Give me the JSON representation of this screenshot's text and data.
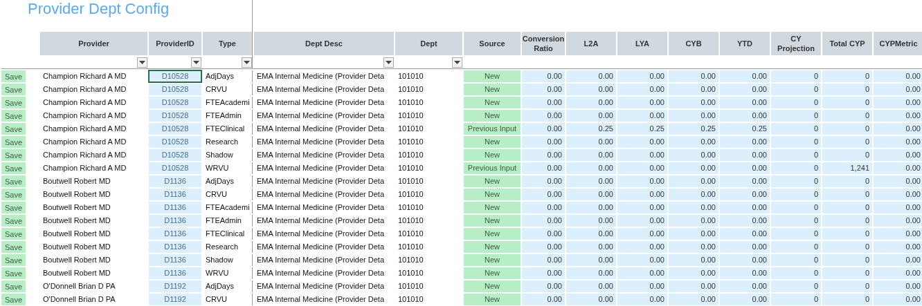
{
  "title": "Provider Dept Config",
  "columns": [
    {
      "label": "Provider",
      "filter": true
    },
    {
      "label": "ProviderID",
      "filter": true
    },
    {
      "label": "Type",
      "filter": true
    },
    {
      "label": "Dept Desc",
      "filter": true
    },
    {
      "label": "Dept",
      "filter": true
    },
    {
      "label": "Source",
      "filter": false
    },
    {
      "label": "Conversion Ratio",
      "filter": false
    },
    {
      "label": "L2A",
      "filter": false
    },
    {
      "label": "LYA",
      "filter": false
    },
    {
      "label": "CYB",
      "filter": false
    },
    {
      "label": "YTD",
      "filter": false
    },
    {
      "label": "CY Projection",
      "filter": false
    },
    {
      "label": "Total CYP",
      "filter": false
    },
    {
      "label": "CYPMetric",
      "filter": false
    }
  ],
  "rows": [
    {
      "id_selected": true,
      "cells": [
        "Save",
        "Champion Richard A MD",
        "D10528",
        "AdjDays",
        "EMA Internal Medicine (Provider Deta",
        "101010",
        "New",
        "0.00",
        "0.00",
        "0.00",
        "0.00",
        "0.00",
        "0",
        "0",
        "0.00"
      ]
    },
    {
      "id_selected": false,
      "cells": [
        "Save",
        "Champion Richard A MD",
        "D10528",
        "CRVU",
        "EMA Internal Medicine (Provider Deta",
        "101010",
        "New",
        "0.00",
        "0.00",
        "0.00",
        "0.00",
        "0.00",
        "0",
        "0",
        "0.00"
      ]
    },
    {
      "id_selected": false,
      "cells": [
        "Save",
        "Champion Richard A MD",
        "D10528",
        "FTEAcademi",
        "EMA Internal Medicine (Provider Deta",
        "101010",
        "New",
        "0.00",
        "0.00",
        "0.00",
        "0.00",
        "0.00",
        "0",
        "0",
        "0.00"
      ]
    },
    {
      "id_selected": false,
      "cells": [
        "Save",
        "Champion Richard A MD",
        "D10528",
        "FTEAdmin",
        "EMA Internal Medicine (Provider Deta",
        "101010",
        "New",
        "0.00",
        "0.00",
        "0.00",
        "0.00",
        "0.00",
        "0",
        "0",
        "0.00"
      ]
    },
    {
      "id_selected": false,
      "cells": [
        "Save",
        "Champion Richard A MD",
        "D10528",
        "FTEClinical",
        "EMA Internal Medicine (Provider Deta",
        "101010",
        "Previous Input",
        "0.00",
        "0.25",
        "0.25",
        "0.25",
        "0.25",
        "0",
        "0",
        "0.00"
      ]
    },
    {
      "id_selected": false,
      "cells": [
        "Save",
        "Champion Richard A MD",
        "D10528",
        "Research",
        "EMA Internal Medicine (Provider Deta",
        "101010",
        "New",
        "0.00",
        "0.00",
        "0.00",
        "0.00",
        "0.00",
        "0",
        "0",
        "0.00"
      ]
    },
    {
      "id_selected": false,
      "cells": [
        "Save",
        "Champion Richard A MD",
        "D10528",
        "Shadow",
        "EMA Internal Medicine (Provider Deta",
        "101010",
        "New",
        "0.00",
        "0.00",
        "0.00",
        "0.00",
        "0.00",
        "0",
        "0",
        "0.00"
      ]
    },
    {
      "id_selected": false,
      "cells": [
        "Save",
        "Champion Richard A MD",
        "D10528",
        "WRVU",
        "EMA Internal Medicine (Provider Deta",
        "101010",
        "Previous Input",
        "0.00",
        "0.00",
        "0.00",
        "0.00",
        "0.00",
        "0",
        "1,241",
        "0.00"
      ]
    },
    {
      "id_selected": false,
      "cells": [
        "Save",
        "Boutwell Robert MD",
        "D1136",
        "AdjDays",
        "EMA Internal Medicine (Provider Deta",
        "101010",
        "New",
        "0.00",
        "0.00",
        "0.00",
        "0.00",
        "0.00",
        "0",
        "0",
        "0.00"
      ]
    },
    {
      "id_selected": false,
      "cells": [
        "Save",
        "Boutwell Robert MD",
        "D1136",
        "CRVU",
        "EMA Internal Medicine (Provider Deta",
        "101010",
        "New",
        "0.00",
        "0.00",
        "0.00",
        "0.00",
        "0.00",
        "0",
        "0",
        "0.00"
      ]
    },
    {
      "id_selected": false,
      "cells": [
        "Save",
        "Boutwell Robert MD",
        "D1136",
        "FTEAcademi",
        "EMA Internal Medicine (Provider Deta",
        "101010",
        "New",
        "0.00",
        "0.00",
        "0.00",
        "0.00",
        "0.00",
        "0",
        "0",
        "0.00"
      ]
    },
    {
      "id_selected": false,
      "cells": [
        "Save",
        "Boutwell Robert MD",
        "D1136",
        "FTEAdmin",
        "EMA Internal Medicine (Provider Deta",
        "101010",
        "New",
        "0.00",
        "0.00",
        "0.00",
        "0.00",
        "0.00",
        "0",
        "0",
        "0.00"
      ]
    },
    {
      "id_selected": false,
      "cells": [
        "Save",
        "Boutwell Robert MD",
        "D1136",
        "FTEClinical",
        "EMA Internal Medicine (Provider Deta",
        "101010",
        "New",
        "0.00",
        "0.00",
        "0.00",
        "0.00",
        "0.00",
        "0",
        "0",
        "0.00"
      ]
    },
    {
      "id_selected": false,
      "cells": [
        "Save",
        "Boutwell Robert MD",
        "D1136",
        "Research",
        "EMA Internal Medicine (Provider Deta",
        "101010",
        "New",
        "0.00",
        "0.00",
        "0.00",
        "0.00",
        "0.00",
        "0",
        "0",
        "0.00"
      ]
    },
    {
      "id_selected": false,
      "cells": [
        "Save",
        "Boutwell Robert MD",
        "D1136",
        "Shadow",
        "EMA Internal Medicine (Provider Deta",
        "101010",
        "New",
        "0.00",
        "0.00",
        "0.00",
        "0.00",
        "0.00",
        "0",
        "0",
        "0.00"
      ]
    },
    {
      "id_selected": false,
      "cells": [
        "Save",
        "Boutwell Robert MD",
        "D1136",
        "WRVU",
        "EMA Internal Medicine (Provider Deta",
        "101010",
        "New",
        "0.00",
        "0.00",
        "0.00",
        "0.00",
        "0.00",
        "0",
        "0",
        "0.00"
      ]
    },
    {
      "id_selected": false,
      "cells": [
        "Save",
        "O'Donnell Brian D PA",
        "D1192",
        "AdjDays",
        "EMA Internal Medicine (Provider Deta",
        "101010",
        "New",
        "0.00",
        "0.00",
        "0.00",
        "0.00",
        "0.00",
        "0",
        "0",
        "0.00"
      ]
    },
    {
      "id_selected": false,
      "cells": [
        "Save",
        "O'Donnell Brian D PA",
        "D1192",
        "CRVU",
        "EMA Internal Medicine (Provider Deta",
        "101010",
        "New",
        "0.00",
        "0.00",
        "0.00",
        "0.00",
        "0.00",
        "0",
        "0",
        "0.00"
      ]
    }
  ]
}
